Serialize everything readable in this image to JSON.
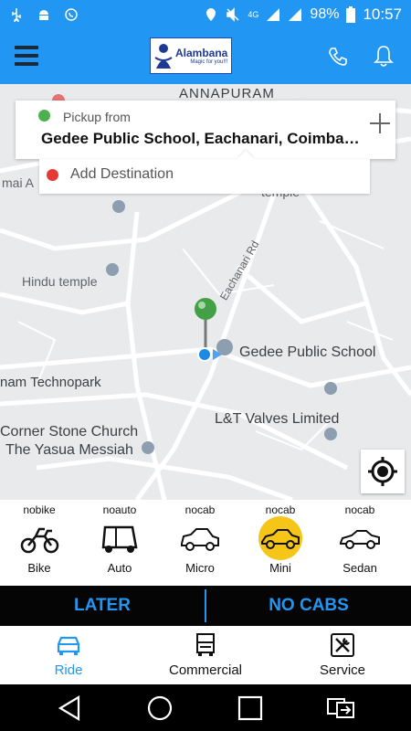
{
  "status_bar": {
    "network": "4G",
    "battery": "98%",
    "time": "10:57"
  },
  "app": {
    "logo_name": "Alambana",
    "logo_tagline": "Magic for you!!!"
  },
  "map": {
    "labels": [
      "ANNAPURAM",
      "mai A",
      "temple",
      "Hindu temple",
      "Eachanari Rd",
      "Gedee Public School",
      "nam Technopark",
      "Corner Stone Church",
      "The Yasua Messiah",
      "L&T Valves Limited"
    ]
  },
  "pickup": {
    "label": "Pickup from",
    "value": "Gedee Public School, Eachanari, Coimbator…"
  },
  "destination": {
    "placeholder": "Add Destination"
  },
  "vehicles": [
    {
      "status": "nobike",
      "name": "Bike",
      "icon": "motorbike-icon",
      "selected": false
    },
    {
      "status": "noauto",
      "name": "Auto",
      "icon": "auto-rickshaw-icon",
      "selected": false
    },
    {
      "status": "nocab",
      "name": "Micro",
      "icon": "micro-car-icon",
      "selected": false
    },
    {
      "status": "nocab",
      "name": "Mini",
      "icon": "mini-car-icon",
      "selected": true
    },
    {
      "status": "nocab",
      "name": "Sedan",
      "icon": "sedan-car-icon",
      "selected": false
    }
  ],
  "actions": {
    "later": "LATER",
    "no_cabs": "NO CABS"
  },
  "tabs": [
    {
      "label": "Ride",
      "icon": "car-icon",
      "active": true
    },
    {
      "label": "Commercial",
      "icon": "truck-icon",
      "active": false
    },
    {
      "label": "Service",
      "icon": "tools-icon",
      "active": false
    }
  ],
  "colors": {
    "primary": "#2196f3",
    "selected": "#f5c518",
    "pickup": "#4caf50",
    "destination": "#e53935"
  }
}
